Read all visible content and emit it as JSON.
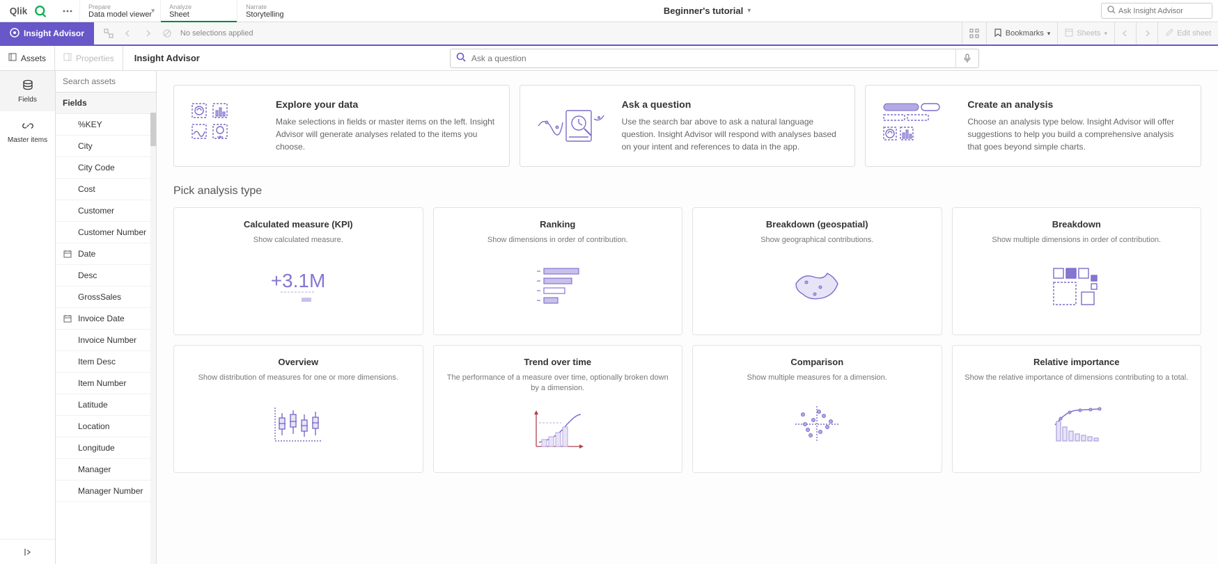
{
  "app_title": "Beginner's tutorial",
  "tabs": [
    {
      "sub": "Prepare",
      "label": "Data model viewer",
      "has_menu": true
    },
    {
      "sub": "Analyze",
      "label": "Sheet",
      "active": true
    },
    {
      "sub": "Narrate",
      "label": "Storytelling"
    }
  ],
  "ask_advisor_placeholder": "Ask Insight Advisor",
  "insight_advisor_btn": "Insight Advisor",
  "no_selections": "No selections applied",
  "bookmarks_label": "Bookmarks",
  "sheets_label": "Sheets",
  "edit_sheet_label": "Edit sheet",
  "panel_assets": "Assets",
  "panel_properties": "Properties",
  "ia_header": "Insight Advisor",
  "search_placeholder": "Ask a question",
  "rail": {
    "fields": "Fields",
    "master": "Master items"
  },
  "assets_search_placeholder": "Search assets",
  "fields_section": "Fields",
  "fields": [
    {
      "label": "%KEY"
    },
    {
      "label": "City"
    },
    {
      "label": "City Code"
    },
    {
      "label": "Cost"
    },
    {
      "label": "Customer"
    },
    {
      "label": "Customer Number"
    },
    {
      "label": "Date",
      "icon": "calendar"
    },
    {
      "label": "Desc"
    },
    {
      "label": "GrossSales"
    },
    {
      "label": "Invoice Date",
      "icon": "calendar"
    },
    {
      "label": "Invoice Number"
    },
    {
      "label": "Item Desc"
    },
    {
      "label": "Item Number"
    },
    {
      "label": "Latitude"
    },
    {
      "label": "Location"
    },
    {
      "label": "Longitude"
    },
    {
      "label": "Manager"
    },
    {
      "label": "Manager Number"
    }
  ],
  "intro_cards": [
    {
      "title": "Explore your data",
      "desc": "Make selections in fields or master items on the left. Insight Advisor will generate analyses related to the items you choose."
    },
    {
      "title": "Ask a question",
      "desc": "Use the search bar above to ask a natural language question. Insight Advisor will respond with analyses based on your intent and references to data in the app."
    },
    {
      "title": "Create an analysis",
      "desc": "Choose an analysis type below. Insight Advisor will offer suggestions to help you build a comprehensive analysis that goes beyond simple charts."
    }
  ],
  "pick_title": "Pick analysis type",
  "analysis_types": [
    {
      "title": "Calculated measure (KPI)",
      "desc": "Show calculated measure.",
      "ill": "kpi"
    },
    {
      "title": "Ranking",
      "desc": "Show dimensions in order of contribution.",
      "ill": "ranking"
    },
    {
      "title": "Breakdown (geospatial)",
      "desc": "Show geographical contributions.",
      "ill": "geo"
    },
    {
      "title": "Breakdown",
      "desc": "Show multiple dimensions in order of contribution.",
      "ill": "breakdown"
    },
    {
      "title": "Overview",
      "desc": "Show distribution of measures for one or more dimensions.",
      "ill": "overview"
    },
    {
      "title": "Trend over time",
      "desc": "The performance of a measure over time, optionally broken down by a dimension.",
      "ill": "trend"
    },
    {
      "title": "Comparison",
      "desc": "Show multiple measures for a dimension.",
      "ill": "comparison"
    },
    {
      "title": "Relative importance",
      "desc": "Show the relative importance of dimensions contributing to a total.",
      "ill": "relative"
    }
  ]
}
